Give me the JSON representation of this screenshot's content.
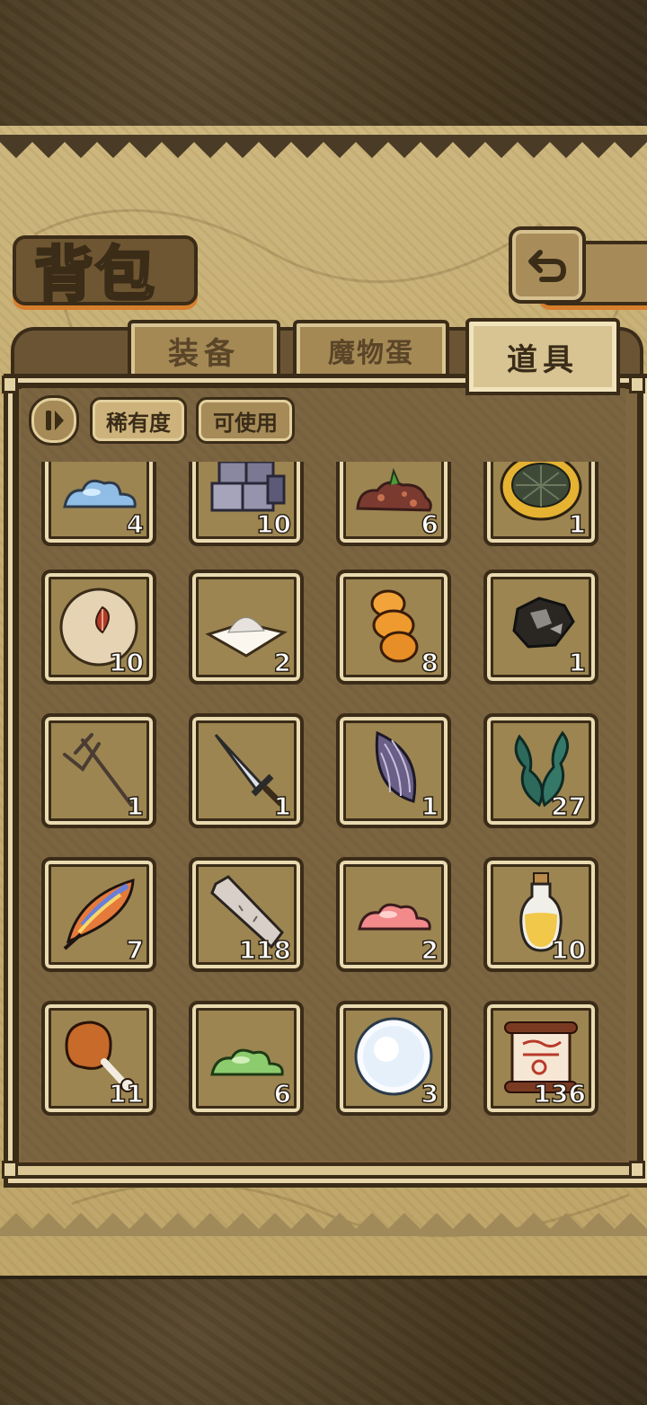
{
  "title": "背包",
  "tabs": [
    {
      "label": "装备",
      "active": false
    },
    {
      "label": "魔物蛋",
      "active": false
    },
    {
      "label": "道具",
      "active": true
    }
  ],
  "filters": {
    "toggle_icon": "pause-sort-icon",
    "rarity_label": "稀有度",
    "usable_label": "可使用"
  },
  "items": [
    {
      "icon": "blue-slime-icon",
      "qty": "4"
    },
    {
      "icon": "stone-blocks-icon",
      "qty": "10"
    },
    {
      "icon": "dirt-pile-icon",
      "qty": "6"
    },
    {
      "icon": "melon-pan-icon",
      "qty": "1"
    },
    {
      "icon": "seed-ball-icon",
      "qty": "10"
    },
    {
      "icon": "flour-pile-icon",
      "qty": "2"
    },
    {
      "icon": "bread-roll-icon",
      "qty": "8"
    },
    {
      "icon": "ore-chunk-icon",
      "qty": "1"
    },
    {
      "icon": "trident-icon",
      "qty": "1"
    },
    {
      "icon": "sword-icon",
      "qty": "1"
    },
    {
      "icon": "sunflower-seed-icon",
      "qty": "1"
    },
    {
      "icon": "seaweed-icon",
      "qty": "27"
    },
    {
      "icon": "feather-icon",
      "qty": "7"
    },
    {
      "icon": "stone-slab-icon",
      "qty": "118"
    },
    {
      "icon": "pink-slime-icon",
      "qty": "2"
    },
    {
      "icon": "oil-bottle-icon",
      "qty": "10"
    },
    {
      "icon": "drumstick-icon",
      "qty": "11"
    },
    {
      "icon": "green-slime-icon",
      "qty": "6"
    },
    {
      "icon": "snowball-icon",
      "qty": "3"
    },
    {
      "icon": "scroll-icon",
      "qty": "136"
    }
  ]
}
